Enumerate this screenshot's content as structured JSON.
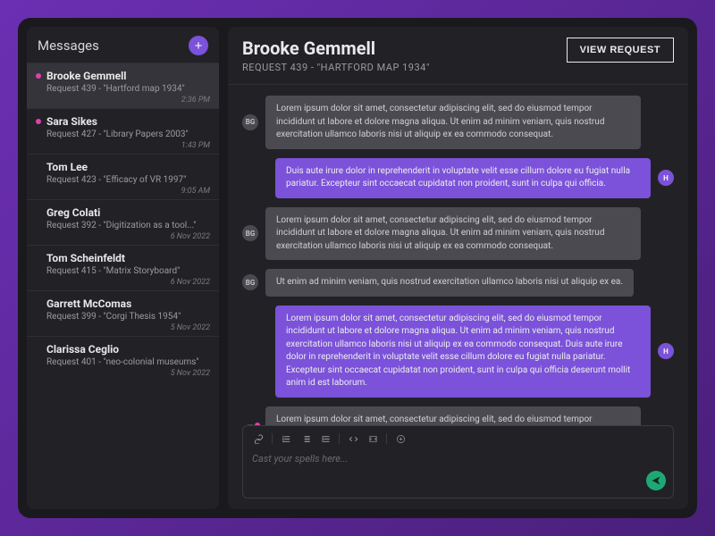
{
  "sidebar": {
    "title": "Messages",
    "add_label": "+",
    "threads": [
      {
        "name": "Brooke Gemmell",
        "sub": "Request 439 - \"Hartford map 1934\"",
        "time": "2:36 PM",
        "unread": true,
        "active": true
      },
      {
        "name": "Sara Sikes",
        "sub": "Request 427 - \"Library Papers 2003\"",
        "time": "1:43 PM",
        "unread": true,
        "active": false
      },
      {
        "name": "Tom Lee",
        "sub": "Request 423 - \"Efficacy of VR 1997\"",
        "time": "9:05 AM",
        "unread": false,
        "active": false
      },
      {
        "name": "Greg Colati",
        "sub": "Request 392 - \"Digitization as a tool...\"",
        "time": "6 Nov 2022",
        "unread": false,
        "active": false
      },
      {
        "name": "Tom Scheinfeldt",
        "sub": "Request 415 - \"Matrix Storyboard\"",
        "time": "6 Nov 2022",
        "unread": false,
        "active": false
      },
      {
        "name": "Garrett McComas",
        "sub": "Request 399 - \"Corgi Thesis 1954\"",
        "time": "5 Nov 2022",
        "unread": false,
        "active": false
      },
      {
        "name": "Clarissa Ceglio",
        "sub": "Request 401 - \"neo-colonial museums\"",
        "time": "5 Nov 2022",
        "unread": false,
        "active": false
      }
    ]
  },
  "header": {
    "title": "Brooke Gemmell",
    "subtitle": "REQUEST 439 - \"HARTFORD MAP 1934\"",
    "view_label": "VIEW REQUEST"
  },
  "avatars": {
    "them": "BG",
    "me": "H"
  },
  "messages": [
    {
      "from": "them",
      "text": "Lorem ipsum dolor sit amet, consectetur adipiscing elit, sed do eiusmod tempor incididunt ut labore et dolore magna aliqua. Ut enim ad minim veniam, quis nostrud exercitation ullamco laboris nisi ut aliquip ex ea commodo consequat.",
      "unread": false
    },
    {
      "from": "me",
      "text": "Duis aute irure dolor in reprehenderit in voluptate velit esse cillum dolore eu fugiat nulla pariatur. Excepteur sint occaecat cupidatat non proident, sunt in culpa qui officia.",
      "unread": false
    },
    {
      "from": "them",
      "text": "Lorem ipsum dolor sit amet, consectetur adipiscing elit, sed do eiusmod tempor incididunt ut labore et dolore magna aliqua. Ut enim ad minim veniam, quis nostrud exercitation ullamco laboris nisi ut aliquip ex ea commodo consequat.",
      "unread": false
    },
    {
      "from": "them",
      "text": "Ut enim ad minim veniam, quis nostrud exercitation ullamco laboris nisi ut aliquip ex ea.",
      "unread": false
    },
    {
      "from": "me",
      "text": "Lorem ipsum dolor sit amet, consectetur adipiscing elit, sed do eiusmod tempor incididunt ut labore et dolore magna aliqua. Ut enim ad minim veniam, quis nostrud exercitation ullamco laboris nisi ut aliquip ex ea commodo consequat. Duis aute irure dolor in reprehenderit in voluptate velit esse cillum dolore eu fugiat nulla pariatur. Excepteur sint occaecat cupidatat non proident, sunt in culpa qui officia deserunt mollit anim id est laborum.",
      "unread": false
    },
    {
      "from": "them",
      "text": "Lorem ipsum dolor sit amet, consectetur adipiscing elit, sed do eiusmod tempor incididunt ut labore et dolore magna aliqua. Ut enim ad minim veniam, quis nostrud exercitation ullamco laboris nisi ut aliquip ex ea commodo consequat.",
      "unread": true
    }
  ],
  "composer": {
    "placeholder": "Cast your spells here..."
  }
}
